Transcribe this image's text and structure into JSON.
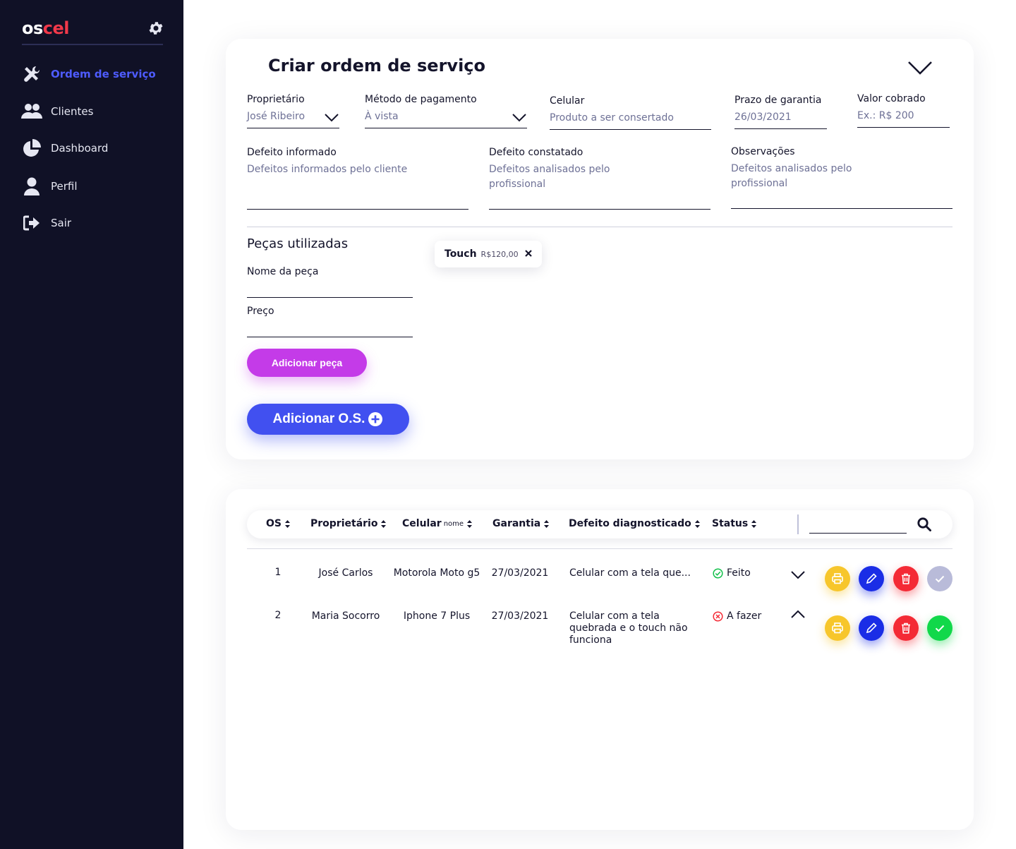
{
  "sidebar": {
    "logo_part1": "os",
    "logo_part2": "cel",
    "items": [
      {
        "label": "Ordem de serviço",
        "icon": "tools-icon",
        "active": true
      },
      {
        "label": "Clientes",
        "icon": "users-icon",
        "active": false
      },
      {
        "label": "Dashboard",
        "icon": "pie-chart-icon",
        "active": false
      },
      {
        "label": "Perfil",
        "icon": "user-icon",
        "active": false
      },
      {
        "label": "Sair",
        "icon": "logout-icon",
        "active": false
      }
    ]
  },
  "form": {
    "title": "Criar ordem de serviço",
    "owner": {
      "label": "Proprietário",
      "value": "José Ribeiro"
    },
    "payment": {
      "label": "Método de pagamento",
      "value": "À vista"
    },
    "phone": {
      "label": "Celular",
      "placeholder": "Produto a ser consertado"
    },
    "warranty": {
      "label": "Prazo de garantia",
      "value": "26/03/2021"
    },
    "price": {
      "label": "Valor cobrado",
      "placeholder": "Ex.: R$ 200"
    },
    "reported_defect": {
      "label": "Defeito informado",
      "placeholder": "Defeitos informados pelo cliente"
    },
    "found_defect": {
      "label": "Defeito constatado",
      "placeholder_line1": "Defeitos analisados pelo",
      "placeholder_line2": "profissional"
    },
    "notes": {
      "label": "Observações",
      "placeholder_line1": "Defeitos analisados pelo",
      "placeholder_line2": "profissional"
    },
    "parts_title": "Peças utilizadas",
    "part_name_label": "Nome da peça",
    "part_price_label": "Preço",
    "add_part_button": "Adicionar peça",
    "add_os_button": "Adicionar O.S.",
    "chip": {
      "name": "Touch",
      "price": "R$120,00"
    }
  },
  "table": {
    "headers": {
      "os": "OS",
      "owner": "Proprietário",
      "phone": "Celular",
      "phone_sub": "nome",
      "warranty": "Garantia",
      "defect": "Defeito diagnosticado",
      "status": "Status"
    },
    "rows": [
      {
        "os": "1",
        "owner": "José Carlos",
        "phone": "Motorola Moto g5",
        "warranty": "27/03/2021",
        "defect_line1": "Celular com a tela que...",
        "defect_line2": "",
        "defect_line3": "",
        "status": "Feito",
        "status_color": "#11c04a",
        "expanded": false
      },
      {
        "os": "2",
        "owner": "Maria Socorro",
        "phone": "Iphone 7 Plus",
        "warranty": "27/03/2021",
        "defect_line1": "Celular com a tela",
        "defect_line2": "quebrada e o touch não",
        "defect_line3": "funciona",
        "status": "A fazer",
        "status_color": "#f42a35",
        "expanded": true
      }
    ]
  },
  "colors": {
    "sidebar_bg": "#101126",
    "accent_blue": "#4150f0",
    "accent_purple": "#c43be8",
    "logo_red": "#f2394a",
    "print": "#f7c62b",
    "edit": "#1a2de6",
    "delete": "#f42a35",
    "done": "#11d84a"
  }
}
